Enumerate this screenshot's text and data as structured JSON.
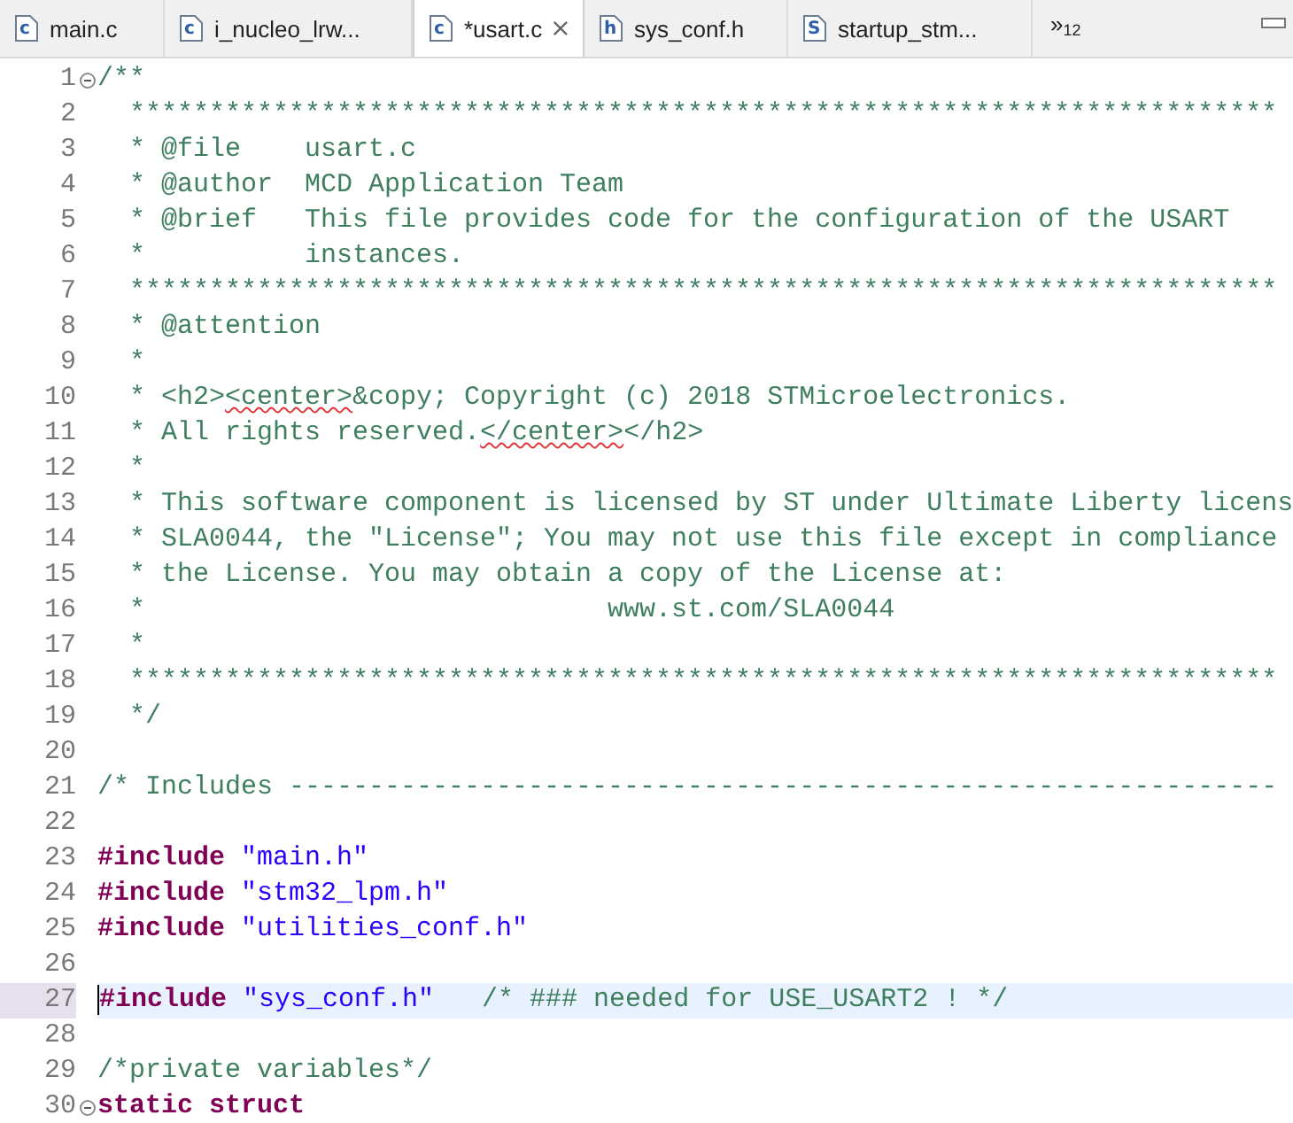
{
  "tabs": [
    {
      "label": "main.c",
      "icon": "c",
      "selected": false
    },
    {
      "label": "i_nucleo_lrw...",
      "icon": "c",
      "selected": false
    },
    {
      "label": "*usart.c",
      "icon": "c",
      "selected": true
    },
    {
      "label": "sys_conf.h",
      "icon": "h",
      "selected": false
    },
    {
      "label": "startup_stm...",
      "icon": "S",
      "selected": false
    }
  ],
  "overflow": {
    "symbol": "»",
    "count": "12"
  },
  "editor": {
    "lines": [
      {
        "number": "1",
        "expanded": true,
        "current": false,
        "segments": [
          {
            "kind": "comment",
            "text": "/**"
          }
        ]
      },
      {
        "number": "2",
        "current": false,
        "segments": [
          {
            "kind": "comment",
            "text": "  ************************************************************************"
          }
        ]
      },
      {
        "number": "3",
        "current": false,
        "segments": [
          {
            "kind": "comment",
            "text": "  * @file    usart.c"
          }
        ]
      },
      {
        "number": "4",
        "current": false,
        "segments": [
          {
            "kind": "comment",
            "text": "  * @author  MCD Application Team"
          }
        ]
      },
      {
        "number": "5",
        "current": false,
        "segments": [
          {
            "kind": "comment",
            "text": "  * @brief   This file provides code for the configuration of the USART"
          }
        ]
      },
      {
        "number": "6",
        "current": false,
        "segments": [
          {
            "kind": "comment",
            "text": "  *          instances."
          }
        ]
      },
      {
        "number": "7",
        "current": false,
        "segments": [
          {
            "kind": "comment",
            "text": "  ************************************************************************"
          }
        ]
      },
      {
        "number": "8",
        "current": false,
        "segments": [
          {
            "kind": "comment",
            "text": "  * @attention"
          }
        ]
      },
      {
        "number": "9",
        "current": false,
        "segments": [
          {
            "kind": "comment",
            "text": "  *"
          }
        ]
      },
      {
        "number": "10",
        "current": false,
        "segments": [
          {
            "kind": "comment",
            "text": "  * <h2>"
          },
          {
            "kind": "misspelled",
            "text": "<center>"
          },
          {
            "kind": "comment",
            "text": "&copy; Copyright (c) 2018 STMicroelectronics."
          }
        ]
      },
      {
        "number": "11",
        "current": false,
        "segments": [
          {
            "kind": "comment",
            "text": "  * All rights reserved."
          },
          {
            "kind": "misspelled",
            "text": "</center>"
          },
          {
            "kind": "comment",
            "text": "</h2>"
          }
        ]
      },
      {
        "number": "12",
        "current": false,
        "segments": [
          {
            "kind": "comment",
            "text": "  *"
          }
        ]
      },
      {
        "number": "13",
        "current": false,
        "segments": [
          {
            "kind": "comment",
            "text": "  * This software component is licensed by ST under Ultimate Liberty licens"
          }
        ]
      },
      {
        "number": "14",
        "current": false,
        "segments": [
          {
            "kind": "comment",
            "text": "  * SLA0044, the \"License\"; You may not use this file except in compliance"
          }
        ]
      },
      {
        "number": "15",
        "current": false,
        "segments": [
          {
            "kind": "comment",
            "text": "  * the License. You may obtain a copy of the License at:"
          }
        ]
      },
      {
        "number": "16",
        "current": false,
        "segments": [
          {
            "kind": "comment",
            "text": "  *                             www.st.com/SLA0044"
          }
        ]
      },
      {
        "number": "17",
        "current": false,
        "segments": [
          {
            "kind": "comment",
            "text": "  *"
          }
        ]
      },
      {
        "number": "18",
        "current": false,
        "segments": [
          {
            "kind": "comment",
            "text": "  ************************************************************************"
          }
        ]
      },
      {
        "number": "19",
        "current": false,
        "segments": [
          {
            "kind": "comment",
            "text": "  */"
          }
        ]
      },
      {
        "number": "20",
        "current": false
      },
      {
        "number": "21",
        "current": false,
        "segments": [
          {
            "kind": "comment",
            "text": "/* Includes --------------------------------------------------------------"
          }
        ]
      },
      {
        "number": "22",
        "current": false
      },
      {
        "number": "23",
        "current": false,
        "segments": [
          {
            "kind": "keyword",
            "text": "#include"
          },
          {
            "kind": "string",
            "text": "\"main.h\""
          }
        ]
      },
      {
        "number": "24",
        "current": false,
        "segments": [
          {
            "kind": "keyword",
            "text": "#include"
          },
          {
            "kind": "string",
            "text": "\"stm32_lpm.h\""
          }
        ]
      },
      {
        "number": "25",
        "current": false,
        "segments": [
          {
            "kind": "keyword",
            "text": "#include"
          },
          {
            "kind": "string",
            "text": "\"utilities_conf.h\""
          }
        ]
      },
      {
        "number": "26",
        "current": false
      },
      {
        "number": "27",
        "current": true,
        "segments": [
          {
            "kind": "keyword",
            "text": "#include"
          },
          {
            "kind": "string",
            "text": "\"sys_conf.h\""
          },
          {
            "kind": "comment",
            "text": "/* ### needed for USE_USART2 ! */"
          }
        ]
      },
      {
        "number": "28",
        "current": false
      },
      {
        "number": "29",
        "current": false,
        "segments": [
          {
            "kind": "comment",
            "text": "/*private variables*/"
          }
        ]
      },
      {
        "number": "30",
        "expanded": true,
        "current": false,
        "segments": [
          {
            "kind": "keyword",
            "text": "static struct"
          }
        ]
      }
    ]
  }
}
